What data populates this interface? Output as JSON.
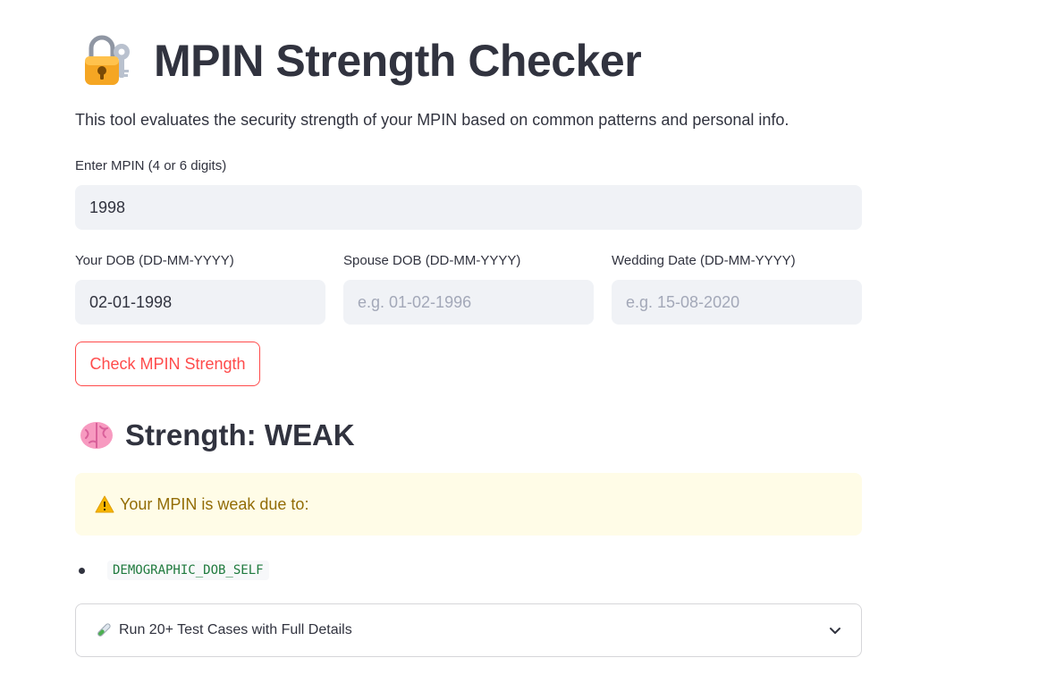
{
  "title": "MPIN Strength Checker",
  "description": "This tool evaluates the security strength of your MPIN based on common patterns and personal info.",
  "mpin": {
    "label": "Enter MPIN (4 or 6 digits)",
    "value": "1998"
  },
  "dob_self": {
    "label": "Your DOB (DD-MM-YYYY)",
    "value": "02-01-1998"
  },
  "dob_spouse": {
    "label": "Spouse DOB (DD-MM-YYYY)",
    "value": "",
    "placeholder": "e.g. 01-02-1996"
  },
  "wedding": {
    "label": "Wedding Date (DD-MM-YYYY)",
    "value": "",
    "placeholder": "e.g. 15-08-2020"
  },
  "check_button_label": "Check MPIN Strength",
  "result": {
    "heading": "Strength: WEAK",
    "warning": "Your MPIN is weak due to:",
    "reasons": [
      "DEMOGRAPHIC_DOB_SELF"
    ]
  },
  "expander_label": "Run 20+ Test Cases with Full Details",
  "icons": {
    "title": "lock-with-key-icon",
    "strength": "brain-icon",
    "warning": "warning-icon",
    "expander": "test-tube-icon",
    "expander_toggle": "chevron-down-icon"
  },
  "colors": {
    "accent": "#ff4b4b",
    "input_bg": "#f0f2f6",
    "warning_bg": "#fffce7",
    "warning_text": "#926c05",
    "code_text": "#1f7a3e"
  }
}
